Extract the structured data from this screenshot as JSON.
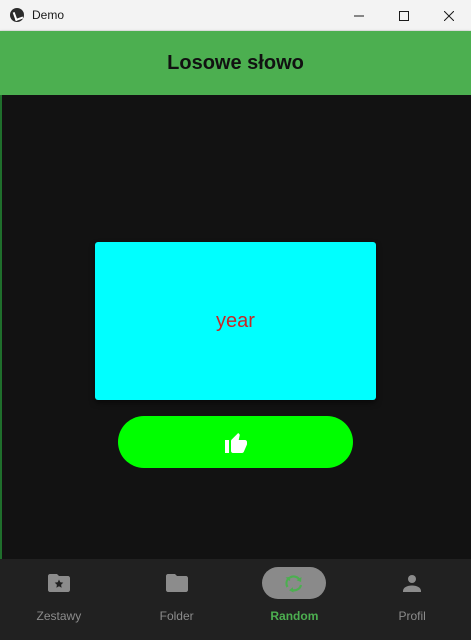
{
  "window": {
    "title": "Demo",
    "app_icon": "kivy-icon",
    "controls": [
      "minimize-icon",
      "maximize-icon",
      "close-icon"
    ]
  },
  "appbar": {
    "title": "Losowe słowo",
    "color": "#4caf50"
  },
  "card": {
    "word": "year",
    "background": "#00ffff",
    "text_color": "#c62828"
  },
  "like_button": {
    "icon": "thumb-up-icon",
    "background": "#00ff00"
  },
  "bottom_nav": {
    "items": [
      {
        "label": "Zestawy",
        "icon": "folder-star-icon",
        "active": false
      },
      {
        "label": "Folder",
        "icon": "folder-icon",
        "active": false
      },
      {
        "label": "Random",
        "icon": "recycle-icon",
        "active": true
      },
      {
        "label": "Profil",
        "icon": "account-icon",
        "active": false
      }
    ],
    "active_color": "#4caf50"
  }
}
